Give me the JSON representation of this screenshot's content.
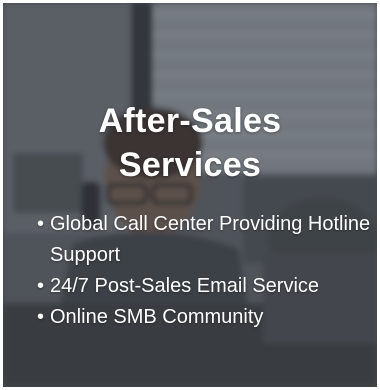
{
  "panel": {
    "title_line1": "After-Sales",
    "title_line2": "Services",
    "bullet_glyph": "•",
    "items": [
      {
        "label": "Global Call Center Providing Hotline Support"
      },
      {
        "label": "24/7 Post-Sales Email Service"
      },
      {
        "label": "Online SMB Community"
      }
    ]
  },
  "colors": {
    "text": "#ffffff",
    "overlay": "#3c4046"
  }
}
